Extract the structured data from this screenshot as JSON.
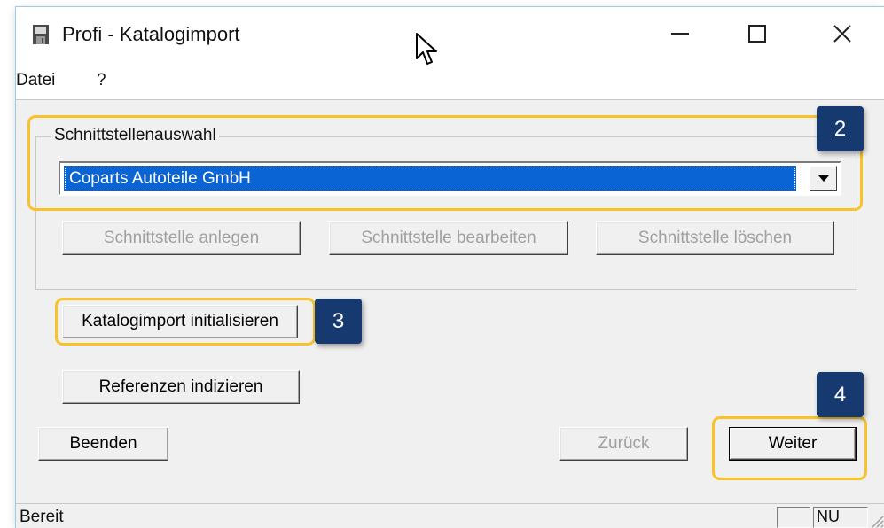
{
  "window": {
    "title": "Profi - Katalogimport",
    "controls": [
      "minimize",
      "maximize",
      "close"
    ]
  },
  "menu": {
    "items": [
      "Datei",
      "?"
    ]
  },
  "interface_group": {
    "label": "Schnittstellenauswahl",
    "selected_interface": "Coparts Autoteile GmbH",
    "buttons": {
      "create": "Schnittstelle anlegen",
      "edit": "Schnittstelle bearbeiten",
      "delete": "Schnittstelle löschen"
    }
  },
  "actions": {
    "init_import": "Katalogimport initialisieren",
    "index_refs": "Referenzen indizieren"
  },
  "navigation": {
    "quit": "Beenden",
    "back": "Zurück",
    "next": "Weiter"
  },
  "annotations": {
    "step2": "2",
    "step3": "3",
    "step4": "4"
  },
  "status": {
    "text": "Bereit",
    "num_lock": "NU"
  },
  "colors": {
    "highlight": "#f7c22a",
    "badge": "#163a70",
    "selection": "#0a64d4"
  },
  "icons": [
    "app-icon",
    "minimize-icon",
    "maximize-icon",
    "close-icon",
    "dropdown-arrow-icon",
    "mouse-cursor-icon",
    "resize-grip-icon"
  ]
}
